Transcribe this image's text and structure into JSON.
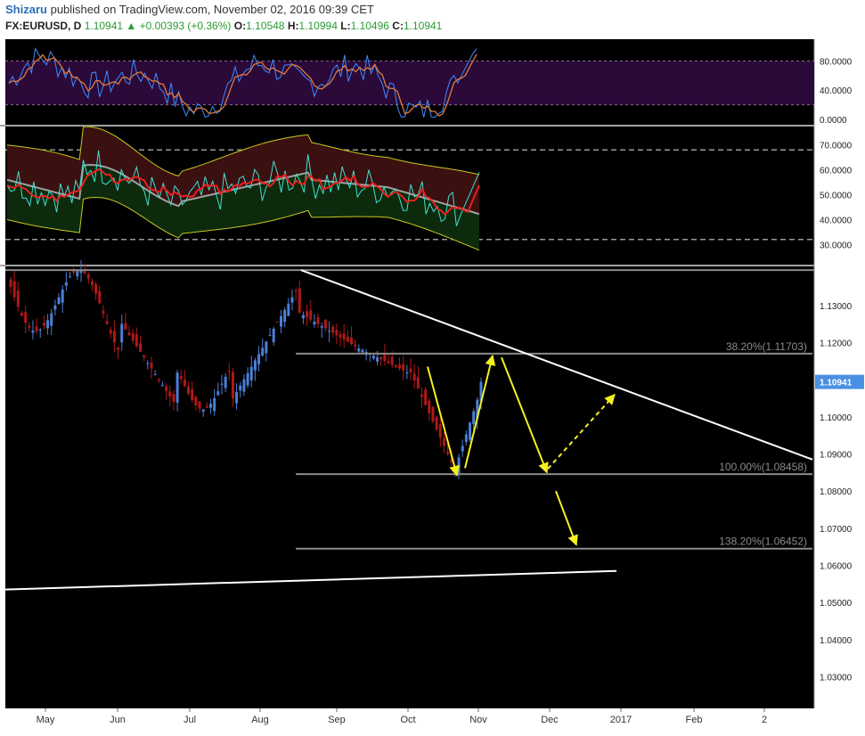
{
  "header": {
    "author": "Shizaru",
    "published_text": "published on TradingView.com, November 02, 2016 09:39 CET",
    "symbol": "FX:EURUSD, D",
    "last": "1.10941",
    "change_arrow": "▲",
    "change": "+0.00393 (+0.36%)",
    "open_label": "O:",
    "open": "1.10548",
    "high_label": "H:",
    "high": "1.10994",
    "low_label": "L:",
    "low": "1.10496",
    "close_label": "C:",
    "close": "1.10941"
  },
  "colors": {
    "background": "#000000",
    "up_candle": "#4a7fd6",
    "down_candle": "#b01818",
    "stoch_bg": "#2b0a3a",
    "stoch_k": "#3d8bff",
    "stoch_d": "#e07a3a",
    "rsi_upper": "#c8c820",
    "rsi_mid": "#a0a0a0",
    "rsi_fast": "#e82020",
    "rsi_slow": "#40e0d0",
    "arrows": "#f5f020",
    "trendline": "#ffffff",
    "fib": "#8a8a8a",
    "price_tag": "#4a90e2"
  },
  "chart_data": [
    {
      "type": "line",
      "panel": "stochastic",
      "y_ticks": [
        "80.0000",
        "40.0000",
        "0.0000"
      ],
      "ylim": [
        0,
        100
      ],
      "levels": [
        80,
        20
      ],
      "series": []
    },
    {
      "type": "area",
      "panel": "rsi_bands",
      "y_ticks": [
        "70.0000",
        "60.0000",
        "50.0000",
        "40.0000",
        "30.0000"
      ],
      "ylim": [
        24,
        76
      ],
      "levels": [
        68,
        32
      ],
      "series": []
    },
    {
      "type": "candlestick",
      "panel": "price",
      "symbol": "FX:EURUSD",
      "timeframe": "D",
      "ylim": [
        1.0215,
        1.1405
      ],
      "y_ticks": [
        "1.13000",
        "1.12000",
        "1.11000",
        "1.10000",
        "1.09000",
        "1.08000",
        "1.07000",
        "1.06000",
        "1.05000",
        "1.04000",
        "1.03000"
      ],
      "x_labels": [
        "May",
        "Jun",
        "Jul",
        "Aug",
        "Sep",
        "Oct",
        "Nov",
        "Dec",
        "2017",
        "Feb",
        "2"
      ],
      "price_tag": "1.10941",
      "fib_levels": [
        {
          "label": "38.20%(1.11703)",
          "value": 1.11703
        },
        {
          "label": "100.00%(1.08458)",
          "value": 1.08458
        },
        {
          "label": "138.20%(1.06452)",
          "value": 1.06452
        }
      ],
      "top_level": 1.1395,
      "trendlines": [
        {
          "name": "descending-resistance",
          "from": [
            1.1395
          ],
          "to": [
            1.0885
          ]
        },
        {
          "name": "ascending-support",
          "from": [
            1.0535
          ],
          "to": [
            1.0585
          ]
        }
      ],
      "candles": []
    }
  ]
}
